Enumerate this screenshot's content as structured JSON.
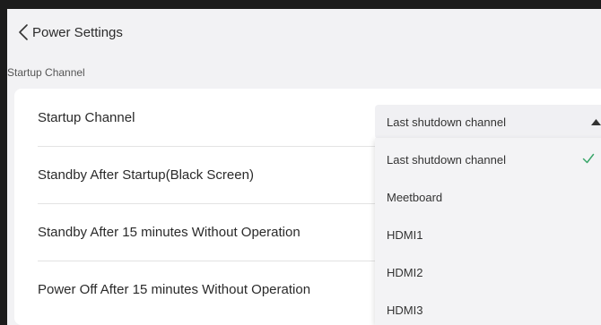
{
  "header": {
    "title": "Power Settings",
    "back_icon": "chevron-left-icon"
  },
  "section": {
    "label": "Startup Channel"
  },
  "settings": {
    "rows": [
      {
        "label": "Startup Channel"
      },
      {
        "label": "Standby After Startup(Black Screen)"
      },
      {
        "label": "Standby After 15 minutes Without Operation"
      },
      {
        "label": "Power Off After 15 minutes Without Operation"
      }
    ]
  },
  "startup_select": {
    "value": "Last shutdown channel",
    "expanded": true,
    "arrow_icon": "caret-up-icon",
    "options": [
      {
        "label": "Last shutdown channel",
        "selected": true
      },
      {
        "label": "Meetboard",
        "selected": false
      },
      {
        "label": "HDMI1",
        "selected": false
      },
      {
        "label": "HDMI2",
        "selected": false
      },
      {
        "label": "HDMI3",
        "selected": false
      }
    ]
  },
  "colors": {
    "accent": "#3aa66a",
    "background": "#f2f2f4",
    "card": "#ffffff",
    "frame": "#1c1c1c"
  }
}
